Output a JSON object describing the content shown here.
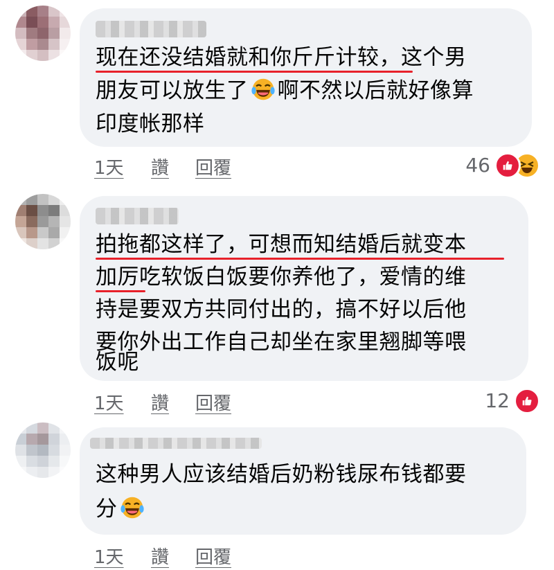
{
  "comments": [
    {
      "lines": [
        "现在还没结婚就和你斤斤计较，这个男",
        "朋友可以放生了",
        "啊不然以后就好像算",
        "印度帐那样"
      ],
      "time": "1天",
      "like": "讚",
      "reply": "回覆",
      "reaction_count": "46",
      "reactions": [
        "like-icon",
        "haha-icon"
      ]
    },
    {
      "lines": [
        "拍拖都这样了，可想而知结婚后就变本",
        "加厉吃软饭白饭要你养他了，爱情的维",
        "持是要双方共同付出的，搞不好以后他",
        "要你外出工作自己却坐在家里翘脚等喂",
        "饭呢"
      ],
      "time": "1天",
      "like": "讚",
      "reply": "回覆",
      "reaction_count": "12",
      "reactions": [
        "like-icon"
      ]
    },
    {
      "lines": [
        "这种男人应该结婚后奶粉钱尿布钱都要",
        "分"
      ],
      "time": "1天",
      "like": "讚",
      "reply": "回覆",
      "reactions": []
    }
  ],
  "colors": {
    "bubble": "#f0f2f5",
    "underline": "#e8212a",
    "meta": "#65676b",
    "like": "#e41e3f",
    "haha": "#f7b125"
  }
}
